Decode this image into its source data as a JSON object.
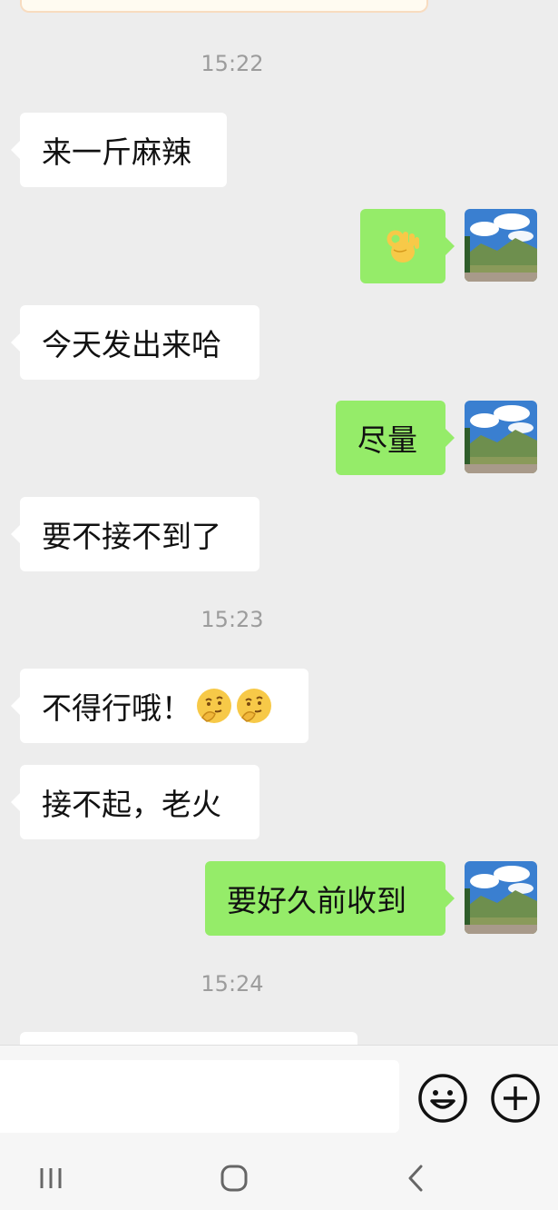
{
  "timestamps": [
    "15:22",
    "15:23",
    "15:24"
  ],
  "messages": [
    {
      "side": "left",
      "text": "来一斤麻辣"
    },
    {
      "side": "right",
      "text": "",
      "emoji": "ok-hand-emoji"
    },
    {
      "side": "left",
      "text": "今天发出来哈"
    },
    {
      "side": "right",
      "text": "尽量"
    },
    {
      "side": "left",
      "text": "要不接不到了"
    },
    {
      "side": "left",
      "text": "不得行哦！",
      "emoji": "thinking-face-emoji x2"
    },
    {
      "side": "left",
      "text": "接不起，老火"
    },
    {
      "side": "right",
      "text": "要好久前收到"
    }
  ],
  "input_bar": {
    "message_value": "",
    "emoji_icon": "smiley-face-icon",
    "add_icon": "plus-circle-icon"
  },
  "navbar": {
    "recents_icon": "recent-apps-icon",
    "home_icon": "home-icon",
    "back_icon": "back-chevron-icon"
  },
  "colors": {
    "background": "#ededed",
    "bubble_left": "#ffffff",
    "bubble_right": "#95ec69",
    "timestamp": "#9c9c9c"
  }
}
